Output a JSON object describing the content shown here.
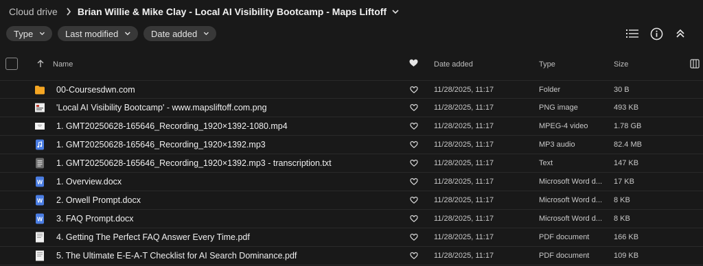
{
  "breadcrumb": {
    "root": "Cloud drive",
    "current": "Brian Willie & Mike Clay - Local AI Visibility Bootcamp - Maps Liftoff"
  },
  "filters": {
    "type": "Type",
    "last_modified": "Last modified",
    "date_added": "Date added"
  },
  "header": {
    "name": "Name",
    "date_added": "Date added",
    "type": "Type",
    "size": "Size"
  },
  "colors": {
    "background": "#191919",
    "chip": "#383838",
    "folder": "#f5a623",
    "word": "#4a7de3",
    "audio": "#4a7de3"
  },
  "files": [
    {
      "name": "00-Coursesdwn.com",
      "date": "11/28/2025, 11:17",
      "type": "Folder",
      "size": "30 B",
      "icon": "folder-icon"
    },
    {
      "name": "'Local AI Visibility Bootcamp' - www.mapsliftoff.com.png",
      "date": "11/28/2025, 11:17",
      "type": "PNG image",
      "size": "493 KB",
      "icon": "image-thumbnail-icon"
    },
    {
      "name": "1. GMT20250628-165646_Recording_1920×1392-1080.mp4",
      "date": "11/28/2025, 11:17",
      "type": "MPEG-4 video",
      "size": "1.78 GB",
      "icon": "video-thumbnail-icon"
    },
    {
      "name": "1. GMT20250628-165646_Recording_1920×1392.mp3",
      "date": "11/28/2025, 11:17",
      "type": "MP3 audio",
      "size": "82.4 MB",
      "icon": "audio-file-icon"
    },
    {
      "name": "1. GMT20250628-165646_Recording_1920×1392.mp3 - transcription.txt",
      "date": "11/28/2025, 11:17",
      "type": "Text",
      "size": "147 KB",
      "icon": "text-file-icon"
    },
    {
      "name": "1. Overview.docx",
      "date": "11/28/2025, 11:17",
      "type": "Microsoft Word d...",
      "size": "17 KB",
      "icon": "word-file-icon"
    },
    {
      "name": "2. Orwell Prompt.docx",
      "date": "11/28/2025, 11:17",
      "type": "Microsoft Word d...",
      "size": "8 KB",
      "icon": "word-file-icon"
    },
    {
      "name": "3. FAQ Prompt.docx",
      "date": "11/28/2025, 11:17",
      "type": "Microsoft Word d...",
      "size": "8 KB",
      "icon": "word-file-icon"
    },
    {
      "name": "4. Getting The Perfect FAQ Answer Every Time.pdf",
      "date": "11/28/2025, 11:17",
      "type": "PDF document",
      "size": "166 KB",
      "icon": "pdf-thumbnail-icon"
    },
    {
      "name": "5. The Ultimate E-E-A-T Checklist for AI Search Dominance.pdf",
      "date": "11/28/2025, 11:17",
      "type": "PDF document",
      "size": "109 KB",
      "icon": "pdf-thumbnail-icon"
    }
  ]
}
